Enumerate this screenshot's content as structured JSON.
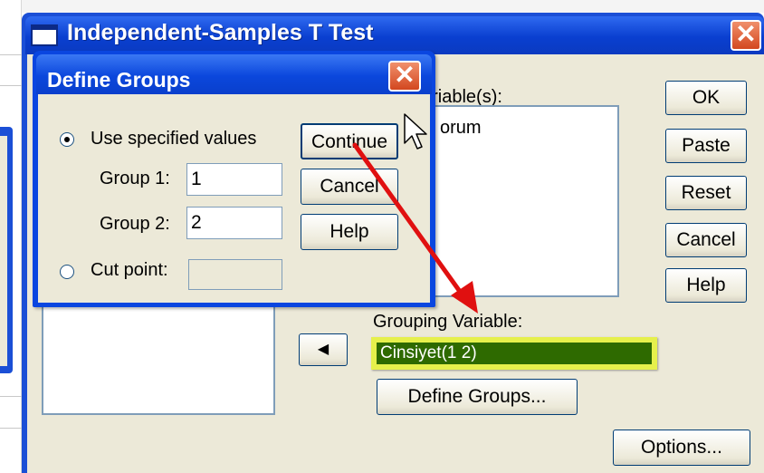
{
  "main_dialog": {
    "title": "Independent-Samples T Test",
    "close_glyph": "✕",
    "test_variables_label": "Test Variable(s):",
    "test_variables_label_visible": "ariable(s):",
    "test_variable_item_visible": "orum",
    "grouping_variable_label": "Grouping Variable:",
    "grouping_variable_value": "Cinsiyet(1 2)",
    "buttons": {
      "ok": "OK",
      "paste": "Paste",
      "reset": "Reset",
      "cancel": "Cancel",
      "help": "Help",
      "define_groups": "Define Groups...",
      "options": "Options...",
      "move_arrow": "◀"
    }
  },
  "define_groups_dialog": {
    "title": "Define Groups",
    "close_glyph": "✕",
    "use_specified_values_label": "Use specified values",
    "use_specified_values_selected": true,
    "group1_label": "Group 1:",
    "group1_value": "1",
    "group2_label": "Group 2:",
    "group2_value": "2",
    "cut_point_label": "Cut point:",
    "cut_point_value": "",
    "cut_point_selected": false,
    "buttons": {
      "continue": "Continue",
      "cancel": "Cancel",
      "help": "Help"
    }
  },
  "annotation": {
    "arrow_color": "#e01010",
    "highlight_color": "#e6f04c"
  }
}
